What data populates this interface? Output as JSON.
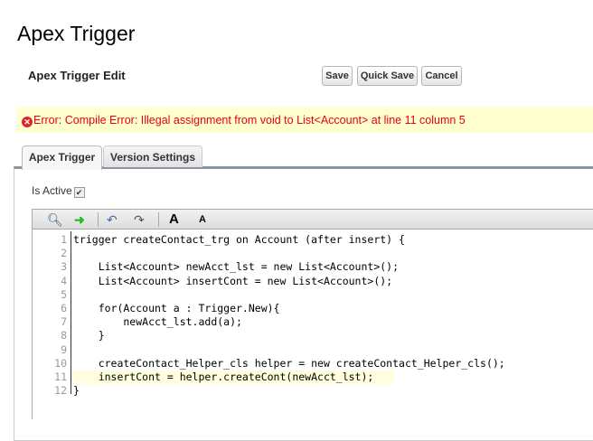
{
  "page": {
    "title": "Apex Trigger",
    "edit_title": "Apex Trigger Edit"
  },
  "buttons": {
    "save": "Save",
    "quick_save": "Quick Save",
    "cancel": "Cancel"
  },
  "error": {
    "icon": "error-x-icon",
    "text": "Error: Compile Error: Illegal assignment from void to List<Account> at line 11 column 5"
  },
  "tabs": [
    {
      "label": "Apex Trigger",
      "active": true
    },
    {
      "label": "Version Settings",
      "active": false
    }
  ],
  "is_active": {
    "label": "Is Active",
    "checked": true
  },
  "toolbar": {
    "icons": [
      "search-icon",
      "go-to-line-icon",
      "undo-icon",
      "redo-icon",
      "font-larger-icon",
      "font-smaller-icon"
    ],
    "larger": "A",
    "smaller": "A"
  },
  "code": {
    "lines": [
      {
        "n": "1",
        "t": "trigger createContact_trg on Account (after insert) {"
      },
      {
        "n": "2",
        "t": ""
      },
      {
        "n": "3",
        "t": "    List<Account> newAcct_lst = new List<Account>();"
      },
      {
        "n": "4",
        "t": "    List<Account> insertCont = new List<Account>();"
      },
      {
        "n": "5",
        "t": ""
      },
      {
        "n": "6",
        "t": "    for(Account a : Trigger.New){"
      },
      {
        "n": "7",
        "t": "        newAcct_lst.add(a);"
      },
      {
        "n": "8",
        "t": "    }"
      },
      {
        "n": "9",
        "t": ""
      },
      {
        "n": "10",
        "t": "    createContact_Helper_cls helper = new createContact_Helper_cls();"
      },
      {
        "n": "11",
        "t": "    insertCont = helper.createCont(newAcct_lst);"
      },
      {
        "n": "12",
        "t": "}"
      }
    ],
    "highlight_line": 11
  }
}
